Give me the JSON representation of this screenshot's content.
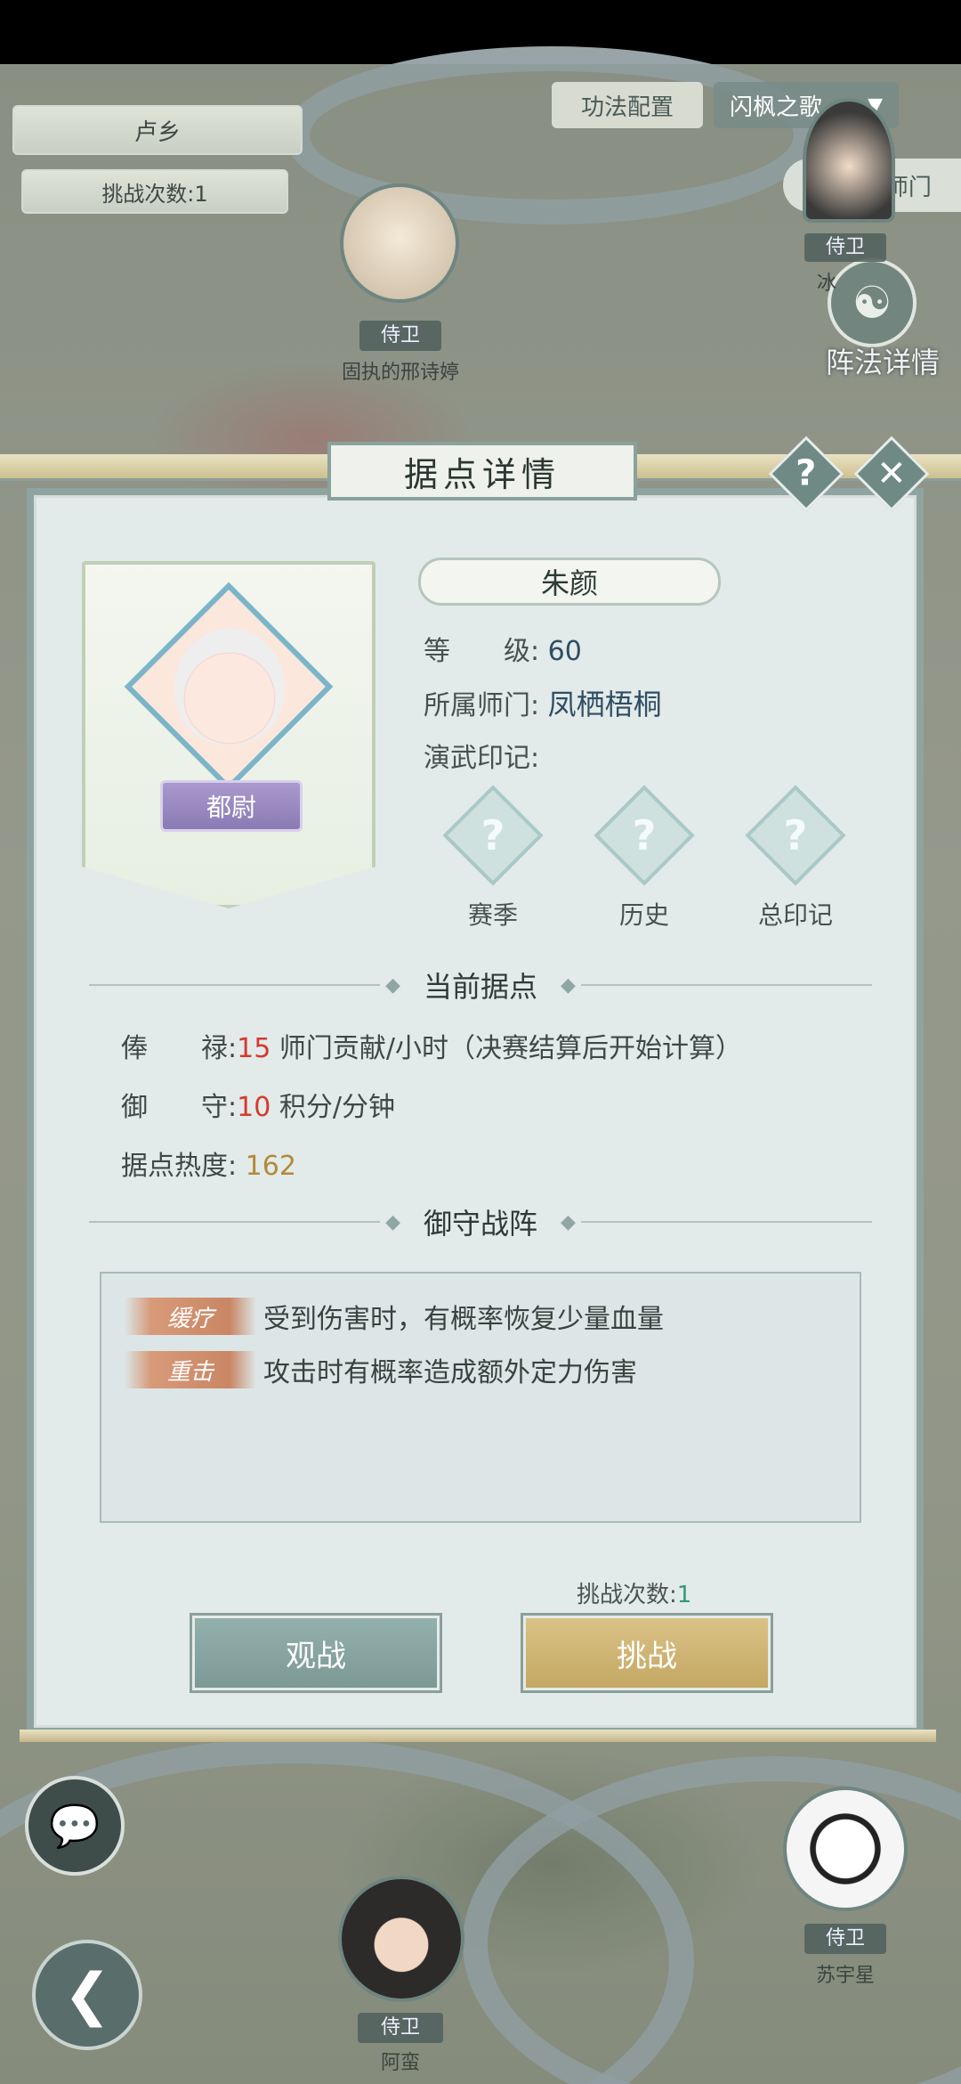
{
  "top": {
    "location": "卢乡",
    "challenge_label": "挑战次数:1",
    "kungfu_config": "功法配置",
    "formation_select": "闪枫之歌",
    "return_sect": "返回师门",
    "formation_detail": "阵法详情"
  },
  "npcs": [
    {
      "role": "侍卫",
      "name": "固执的邢诗婷"
    },
    {
      "role": "侍卫",
      "name": "苏宇星"
    },
    {
      "role": "侍卫",
      "name": "阿蛮"
    },
    {
      "role": "侍卫",
      "name": "冰"
    }
  ],
  "dialog": {
    "title": "据点详情",
    "help": "?",
    "close": "✕",
    "name": "朱颜",
    "rank": "都尉",
    "level_label": "等　　级:",
    "level_value": "60",
    "sect_label": "所属师门:",
    "sect_value": "凤栖梧桐",
    "marks_label": "演武印记:",
    "marks": [
      "赛季",
      "历史",
      "总印记"
    ],
    "current_header": "当前据点",
    "salary_label": "俸　　禄:",
    "salary_value": "15",
    "salary_unit": "师门贡献/小时（决赛结算后开始计算）",
    "defense_label": "御　　守:",
    "defense_value": "10",
    "defense_unit": "积分/分钟",
    "heat_label": "据点热度:",
    "heat_value": "162",
    "formation_header": "御守战阵",
    "skills": [
      {
        "tag": "缓疗",
        "desc": "受到伤害时，有概率恢复少量血量"
      },
      {
        "tag": "重击",
        "desc": "攻击时有概率造成额外定力伤害"
      }
    ],
    "challenge_count_label": "挑战次数:",
    "challenge_count_value": "1",
    "watch_button": "观战",
    "fight_button": "挑战"
  },
  "colors": {
    "accent_teal": "#7c9995",
    "accent_gold": "#c4a763",
    "value_red": "#d43a2c",
    "heat_gold": "#b28a3a"
  },
  "icons": [
    "question-icon",
    "close-icon",
    "chat-icon",
    "back-icon",
    "return-arrow-icon",
    "taiji-icon"
  ]
}
